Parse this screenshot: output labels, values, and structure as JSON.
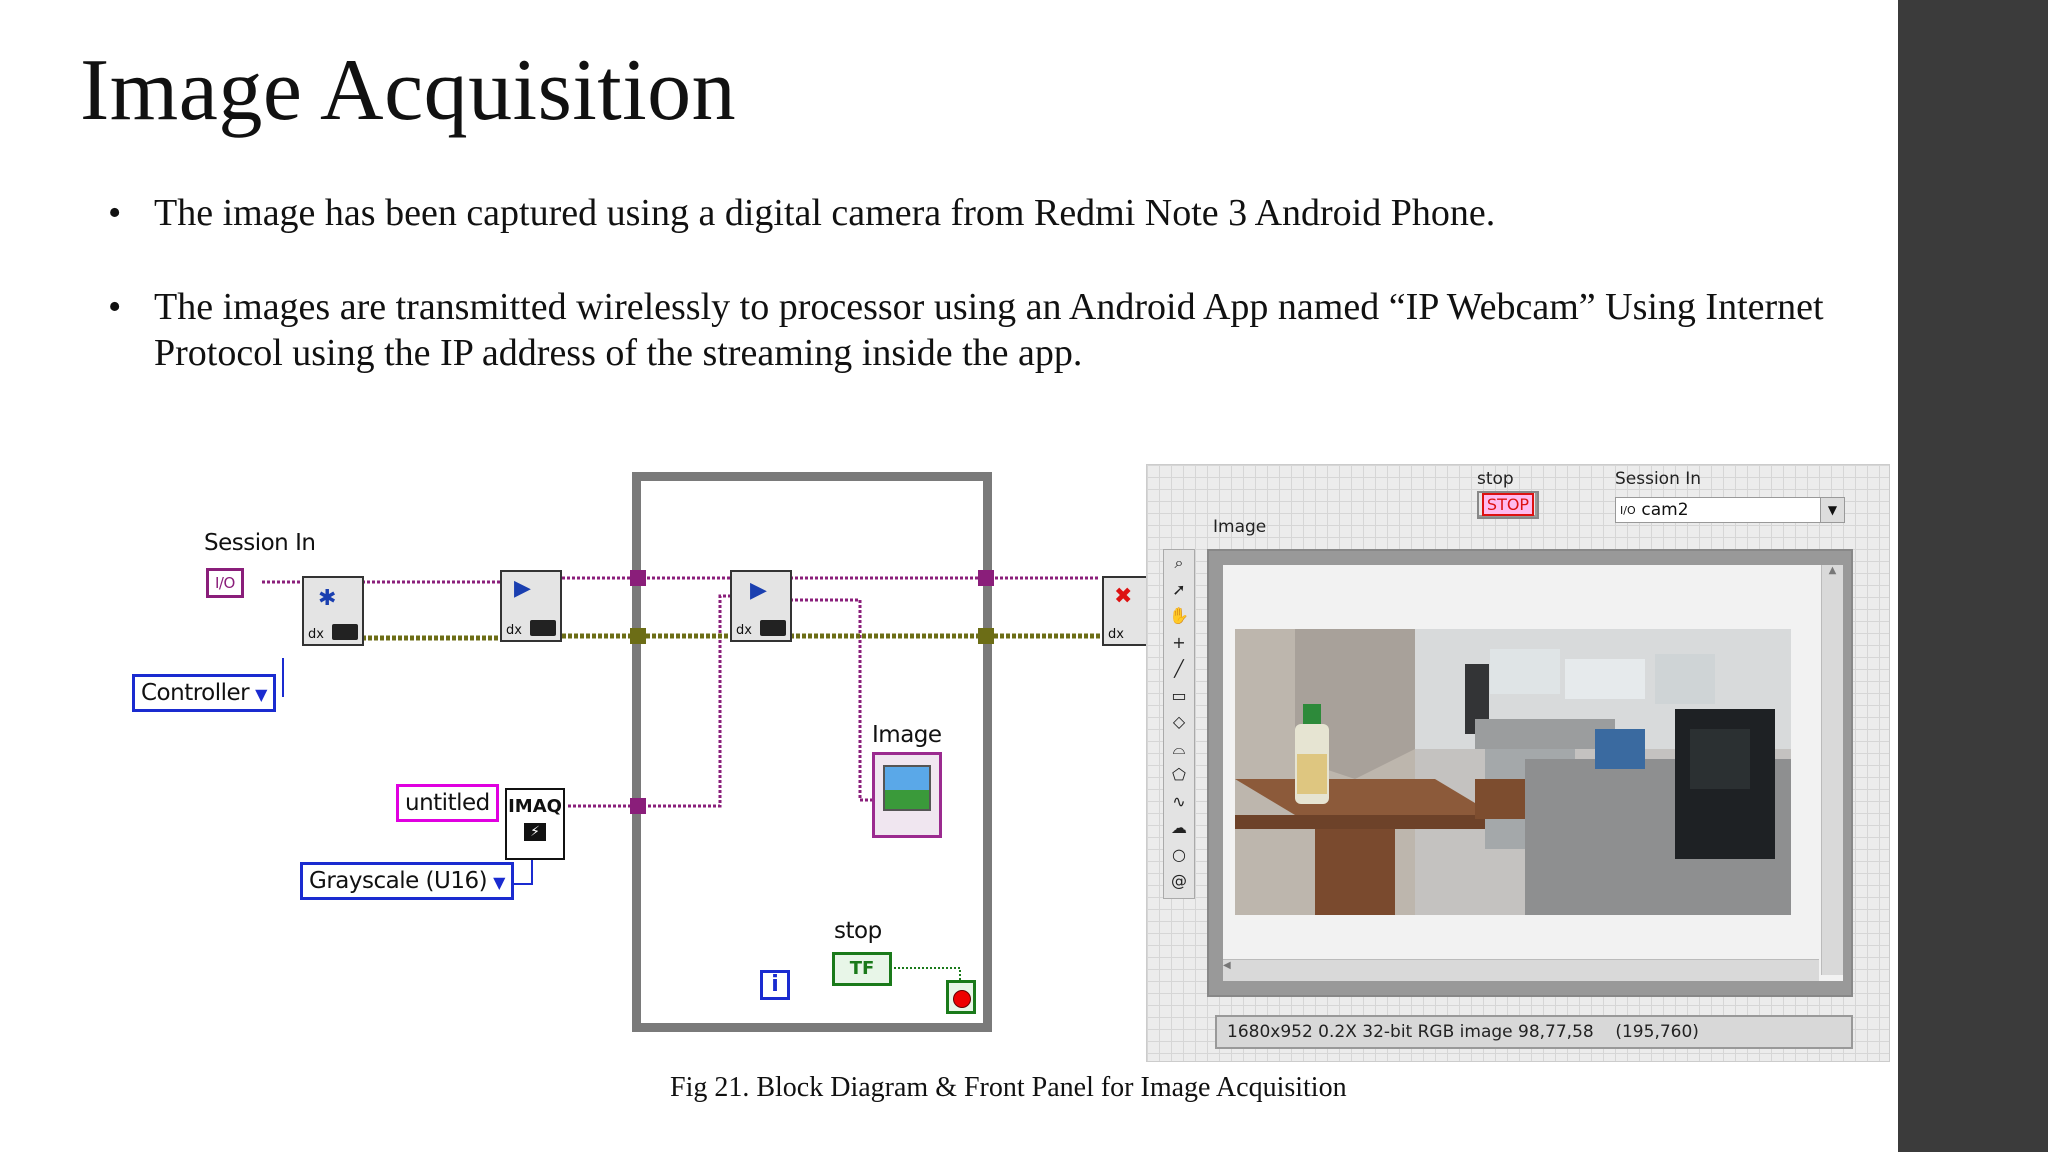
{
  "slide": {
    "title": "Image Acquisition",
    "bullets": [
      "The image has been captured using a digital camera from Redmi Note 3 Android Phone.",
      "The images are transmitted wirelessly to processor using an Android App named “IP Webcam” Using Internet Protocol using the IP address of the streaming inside the app."
    ],
    "caption": "Fig 21. Block Diagram & Front Panel for Image Acquisition"
  },
  "block_diagram": {
    "session_in_label": "Session In",
    "session_constant": "I/O",
    "controller_enum": "Controller",
    "image_name_constant": "untitled",
    "image_type_enum": "Grayscale (U16)",
    "imaq_create_label": "IMAQ",
    "image_indicator_label": "Image",
    "stop_label": "stop",
    "stop_terminal": "TF",
    "iteration_terminal": "i",
    "dx_text": "dx"
  },
  "front_panel": {
    "stop_label": "stop",
    "stop_button": "STOP",
    "session_in_label": "Session In",
    "session_value": "cam2",
    "session_icon": "I/O",
    "image_label": "Image",
    "status_info": "1680x952 0.2X 32-bit RGB image 98,77,58",
    "status_coords": "(195,760)",
    "palette_tools": [
      "zoom-icon",
      "pointer-icon",
      "pan-hand-icon",
      "crosshair-icon",
      "line-icon",
      "rectangle-icon",
      "rotated-rectangle-icon",
      "annulus-icon",
      "polygon-icon",
      "freehand-icon",
      "freehand-region-icon",
      "oval-icon",
      "spiral-icon"
    ]
  },
  "colors": {
    "sidebar": "#3b3b3b",
    "wire_purple": "#8a1e7a",
    "wire_olive": "#6c6d16",
    "wire_blue": "#1a2bd0",
    "wire_green": "#1a7a1a",
    "loop_frame": "#7a7a7a"
  }
}
